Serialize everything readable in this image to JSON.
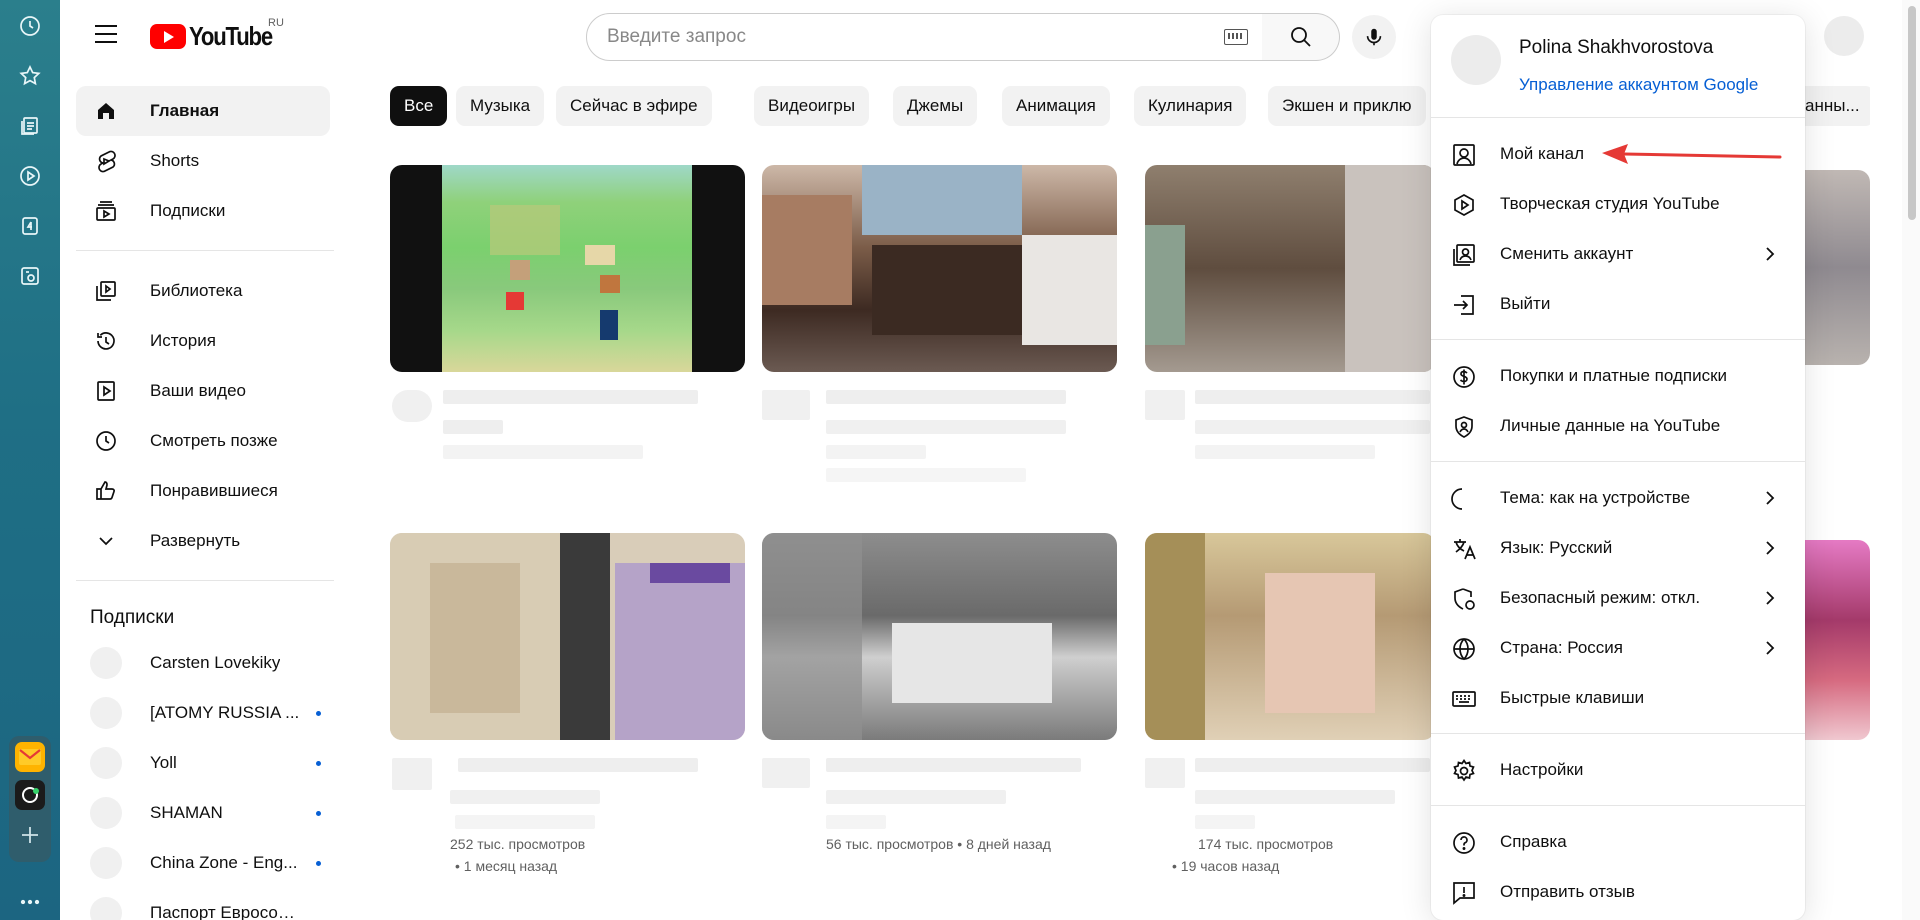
{
  "header": {
    "logo_text": "YouTube",
    "logo_region": "RU",
    "search_placeholder": "Введите запрос"
  },
  "sidebar": {
    "primary": [
      {
        "label": "Главная",
        "icon": "home-icon",
        "active": true
      },
      {
        "label": "Shorts",
        "icon": "shorts-icon"
      },
      {
        "label": "Подписки",
        "icon": "subscriptions-icon"
      }
    ],
    "library": [
      {
        "label": "Библиотека",
        "icon": "library-icon"
      },
      {
        "label": "История",
        "icon": "history-icon"
      },
      {
        "label": "Ваши видео",
        "icon": "your-videos-icon"
      },
      {
        "label": "Смотреть позже",
        "icon": "clock-icon"
      },
      {
        "label": "Понравившиеся",
        "icon": "thumbs-up-icon"
      },
      {
        "label": "Развернуть",
        "icon": "chevron-down-icon"
      }
    ],
    "subscriptions_title": "Подписки",
    "subscriptions": [
      {
        "name": "Carsten Lovekiky",
        "new": false
      },
      {
        "name": "[ATOMY RUSSIA ...",
        "new": true
      },
      {
        "name": "Yoll",
        "new": true
      },
      {
        "name": "SHAMAN",
        "new": true
      },
      {
        "name": "China Zone - Eng...",
        "new": true
      },
      {
        "name": "Паспорт Евросою...",
        "new": false
      }
    ]
  },
  "chips": [
    "Все",
    "Музыка",
    "Сейчас в эфире",
    "Видеоигры",
    "Джемы",
    "Анимация",
    "Кулинария",
    "Экшен и приклю",
    "...ванны..."
  ],
  "videos_row2": [
    {
      "views": "252 тыс. просмотров",
      "age": "• 1 месяц назад"
    },
    {
      "views": "56 тыс. просмотров",
      "age": "• 8 дней назад"
    },
    {
      "views": "174 тыс. просмотров",
      "age": "• 19 часов назад"
    }
  ],
  "account_menu": {
    "user_name": "Polina Shakhvorostova",
    "manage_account": "Управление аккаунтом Google",
    "group1": [
      {
        "label": "Мой канал",
        "icon": "person-icon"
      },
      {
        "label": "Творческая студия YouTube",
        "icon": "studio-icon"
      },
      {
        "label": "Сменить аккаунт",
        "icon": "switch-account-icon",
        "chevron": true
      },
      {
        "label": "Выйти",
        "icon": "sign-out-icon"
      }
    ],
    "group2": [
      {
        "label": "Покупки и платные подписки",
        "icon": "dollar-icon"
      },
      {
        "label": "Личные данные на YouTube",
        "icon": "shield-user-icon"
      }
    ],
    "group3": [
      {
        "label": "Тема: как на устройстве",
        "icon": "moon-icon",
        "chevron": true
      },
      {
        "label": "Язык: Русский",
        "icon": "translate-icon",
        "chevron": true
      },
      {
        "label": "Безопасный режим: откл.",
        "icon": "safety-icon",
        "chevron": true
      },
      {
        "label": "Страна: Россия",
        "icon": "globe-icon",
        "chevron": true
      },
      {
        "label": "Быстрые клавиши",
        "icon": "keyboard-icon"
      }
    ],
    "group4": [
      {
        "label": "Настройки",
        "icon": "gear-icon"
      }
    ],
    "group5": [
      {
        "label": "Справка",
        "icon": "help-icon"
      },
      {
        "label": "Отправить отзыв",
        "icon": "feedback-icon"
      }
    ]
  },
  "colors": {
    "accent": "#065fd4",
    "brand": "#ff0000",
    "annotation_arrow": "#e53935",
    "rail": "#1f6f85"
  }
}
